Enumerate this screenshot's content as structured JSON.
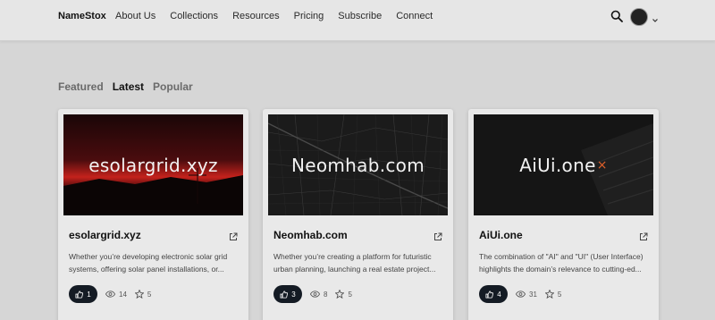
{
  "nav": {
    "brand": "NameStox",
    "links": [
      "About Us",
      "Collections",
      "Resources",
      "Pricing",
      "Subscribe",
      "Connect"
    ]
  },
  "tabs": [
    {
      "label": "Featured",
      "active": false
    },
    {
      "label": "Latest",
      "active": true
    },
    {
      "label": "Popular",
      "active": false
    }
  ],
  "cards": [
    {
      "image_text": "esolargrid.xyz",
      "title": "esolargrid.xyz",
      "desc_line1": "Whether you’re developing electronic solar grid",
      "desc_line2": "systems, offering solar panel installations, or...",
      "likes": "1",
      "views": "14",
      "stars": "5"
    },
    {
      "image_text": "Neomhab.com",
      "title": "Neomhab.com",
      "desc_line1": "Whether you’re creating a platform for futuristic",
      "desc_line2": "urban planning, launching a real estate project...",
      "likes": "3",
      "views": "8",
      "stars": "5"
    },
    {
      "image_text": "AiUi.one",
      "title": "AiUi.one",
      "desc_line1": "The combination of \"AI\" and \"UI\" (User Interface)",
      "desc_line2": "highlights the domain’s relevance to cutting-ed...",
      "likes": "4",
      "views": "31",
      "stars": "5"
    }
  ],
  "colors": {
    "page_bg": "#d6d6d6",
    "nav_bg": "#e6e6e6",
    "card_bg": "#e9e9e9",
    "like_btn_bg": "#141b24",
    "accent_orange": "#e0602a"
  }
}
